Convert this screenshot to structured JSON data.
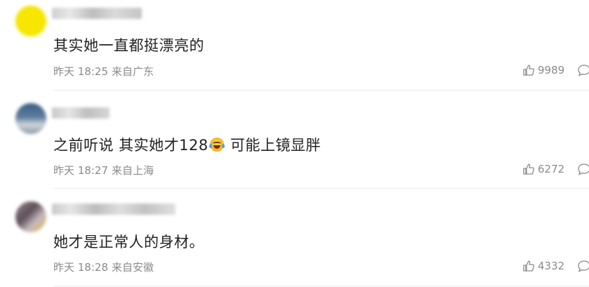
{
  "comments": [
    {
      "text": "其实她一直都挺漂亮的",
      "time": "昨天 18:25",
      "location": "来自广东",
      "likes": "9989",
      "avatar_color": "#f7e600"
    },
    {
      "text_before": "之前听说 其实她才128",
      "emoji": "laughing-crying-emoji",
      "text_after": "可能上镜显胖",
      "time": "昨天 18:27",
      "location": "来自上海",
      "likes": "6272",
      "avatar_color": "#5f7d9c"
    },
    {
      "text": "她才是正常人的身材。",
      "time": "昨天 18:28",
      "location": "来自安徽",
      "likes": "4332",
      "avatar_color": "#7a6a72"
    }
  ],
  "icons": {
    "like": "thumbs-up-icon",
    "reply": "comment-bubble-icon"
  },
  "colors": {
    "text": "#222222",
    "meta": "#8a8a8a",
    "divider": "#ececec"
  }
}
